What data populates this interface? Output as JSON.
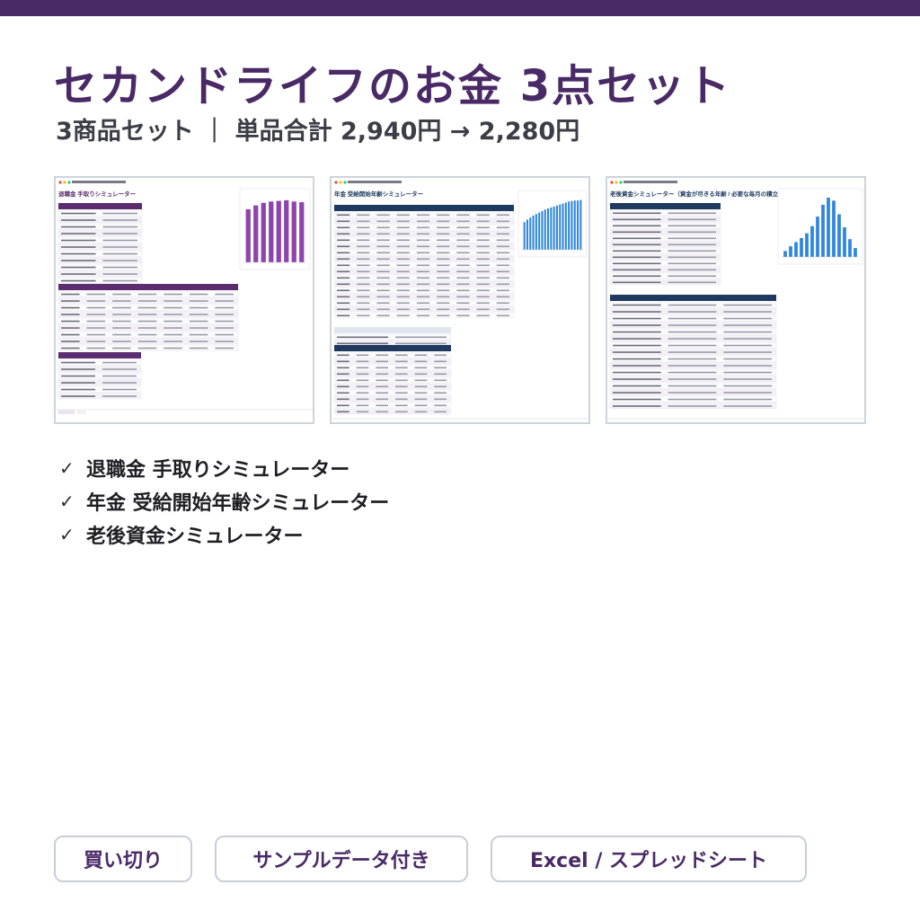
{
  "header": {
    "title": "セカンドライフのお金 3点セット",
    "subtitle": "3商品セット ｜ 単品合計 2,940円 → 2,280円"
  },
  "screenshots": [
    {
      "title": "退職金 手取りシミュレーター",
      "accent": "#5b2c6f",
      "chart_color": "#8e44ad",
      "bar_levels": [
        0.82,
        0.88,
        0.92,
        0.94,
        0.95,
        0.96,
        0.94,
        0.93
      ]
    },
    {
      "title": "年金 受給開始年齢シミュレーター",
      "accent": "#1f3a5f",
      "chart_color": "#2e86de",
      "bar_levels": [
        0.55,
        0.6,
        0.64,
        0.68,
        0.71,
        0.74,
        0.77,
        0.8,
        0.82,
        0.84,
        0.86,
        0.88,
        0.9,
        0.92,
        0.94,
        0.96,
        0.97,
        0.98,
        0.98,
        0.99
      ]
    },
    {
      "title": "老後資金シミュレーター（資金が尽きる年齢 / 必要な毎月の積立額）",
      "accent": "#1f3a5f",
      "chart_color": "#2e86de",
      "bar_levels": [
        0.1,
        0.18,
        0.25,
        0.32,
        0.4,
        0.52,
        0.68,
        0.88,
        1.0,
        0.95,
        0.72,
        0.5,
        0.3,
        0.15
      ]
    }
  ],
  "features": [
    "退職金 手取りシミュレーター",
    "年金 受給開始年齢シミュレーター",
    "老後資金シミュレーター"
  ],
  "check_mark": "✓",
  "tags": [
    "買い切り",
    "サンプルデータ付き",
    "Excel / スプレッドシート"
  ],
  "colors": {
    "brand": "#4a2a66",
    "border": "#c9ced6"
  }
}
